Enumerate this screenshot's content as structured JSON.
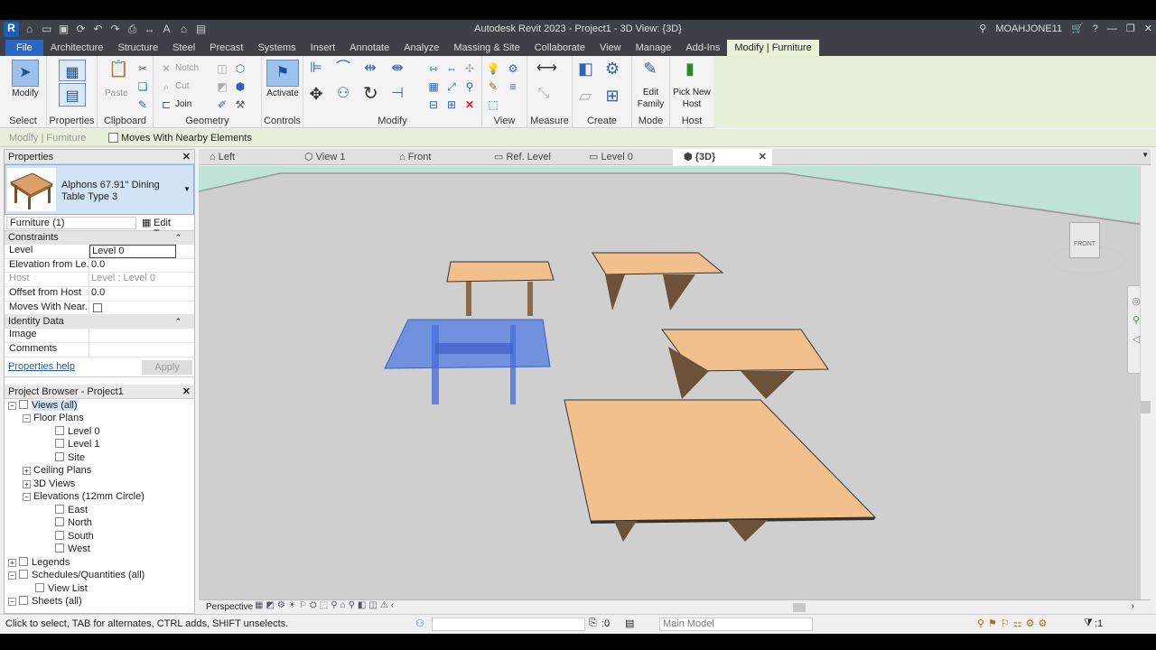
{
  "window": {
    "title": "Autodesk Revit 2023 - Project1 - 3D View: {3D}",
    "user": "MOAHJONE11"
  },
  "ribbon_tabs": [
    "File",
    "Architecture",
    "Structure",
    "Steel",
    "Precast",
    "Systems",
    "Insert",
    "Annotate",
    "Analyze",
    "Massing & Site",
    "Collaborate",
    "View",
    "Manage",
    "Add-Ins",
    "Modify | Furniture"
  ],
  "ribbon": {
    "modify_label": "Modify",
    "paste_label": "Paste",
    "notch_label": "Notch",
    "cut_label": "Cut",
    "join_label": "Join",
    "activate_label": "Activate",
    "edit_family_label": "Edit Family",
    "pick_host_label": "Pick New Host",
    "groups": {
      "select": "Select",
      "properties": "Properties",
      "clipboard": "Clipboard",
      "geometry": "Geometry",
      "controls": "Controls",
      "modify": "Modify",
      "view": "View",
      "measure": "Measure",
      "create": "Create",
      "mode": "Mode",
      "host": "Host"
    }
  },
  "options_bar": {
    "context": "Modify | Furniture",
    "checkbox_label": "Moves With Nearby Elements"
  },
  "properties": {
    "title": "Properties",
    "type_name": "Alphons 67.91'' Dining Table Type 3",
    "filter": "Furniture (1)",
    "edit_type": "Edit Type",
    "sections": {
      "constraints": "Constraints",
      "identity": "Identity Data"
    },
    "rows": [
      {
        "k": "Level",
        "v": "Level 0"
      },
      {
        "k": "Elevation from Le...",
        "v": "0.0"
      },
      {
        "k": "Host",
        "v": "Level : Level 0"
      },
      {
        "k": "Offset from Host",
        "v": "0.0"
      },
      {
        "k": "Moves With Near...",
        "v": ""
      }
    ],
    "identity_rows": [
      {
        "k": "Image",
        "v": ""
      },
      {
        "k": "Comments",
        "v": ""
      }
    ],
    "help": "Properties help",
    "apply": "Apply"
  },
  "browser": {
    "title": "Project Browser - Project1",
    "items": [
      "Views (all)",
      "Floor Plans",
      "Level 0",
      "Level 1",
      "Site",
      "Ceiling Plans",
      "3D Views",
      "Elevations (12mm Circle)",
      "East",
      "North",
      "South",
      "West",
      "Legends",
      "Schedules/Quantities (all)",
      "View List",
      "Sheets (all)"
    ]
  },
  "view_tabs": [
    "Left",
    "View 1",
    "Front",
    "Ref. Level",
    "Level 0",
    "{3D}"
  ],
  "viewcube_label": "FRONT",
  "view_control": {
    "mode": "Perspective"
  },
  "status": {
    "text": "Click to select, TAB for alternates, CTRL adds, SHIFT unselects.",
    "counter": ":0",
    "model": "Main Model",
    "filter_count": ":1"
  }
}
